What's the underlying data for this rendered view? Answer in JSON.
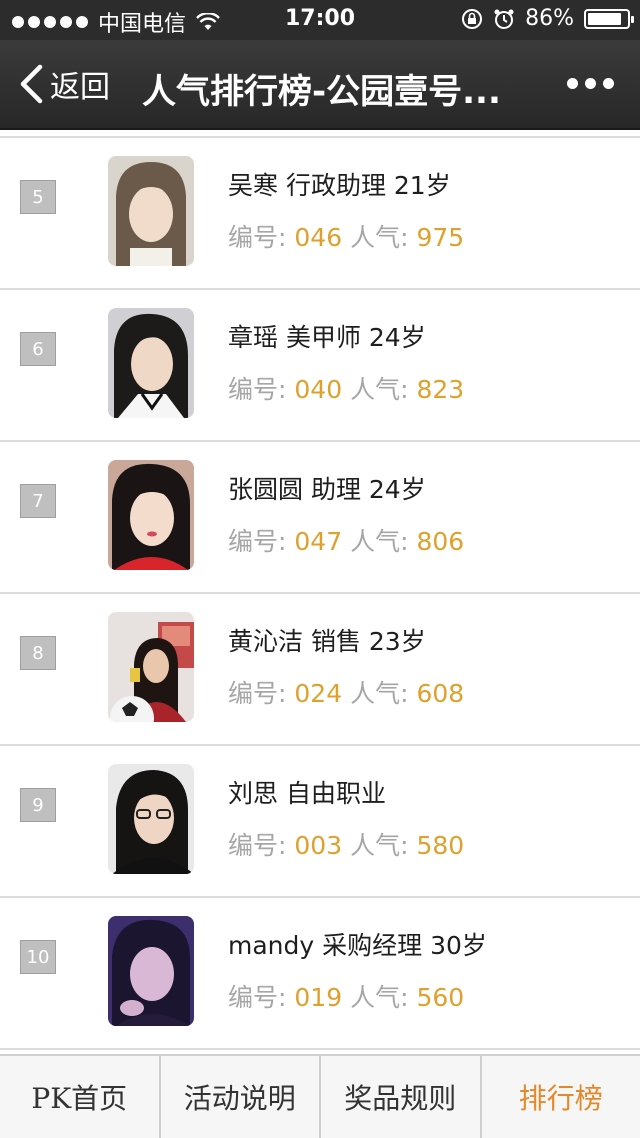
{
  "status": {
    "carrier": "中国电信",
    "time": "17:00",
    "battery": "86%",
    "battery_level": 0.86
  },
  "nav": {
    "back_label": "返回",
    "title": "人气排行榜-公园壹号..."
  },
  "labels": {
    "id_prefix": "编号:",
    "pop_prefix": "人气:"
  },
  "entries": [
    {
      "rank": "5",
      "name": "吴寒 行政助理 21岁",
      "id": "046",
      "popularity": "975"
    },
    {
      "rank": "6",
      "name": "章瑶 美甲师 24岁",
      "id": "040",
      "popularity": "823"
    },
    {
      "rank": "7",
      "name": "张圆圆 助理 24岁",
      "id": "047",
      "popularity": "806"
    },
    {
      "rank": "8",
      "name": "黄沁洁 销售 23岁",
      "id": "024",
      "popularity": "608"
    },
    {
      "rank": "9",
      "name": "刘思 自由职业",
      "id": "003",
      "popularity": "580"
    },
    {
      "rank": "10",
      "name": "mandy 采购经理 30岁",
      "id": "019",
      "popularity": "560"
    }
  ],
  "tabs": [
    {
      "label": "PK首页"
    },
    {
      "label": "活动说明"
    },
    {
      "label": "奖品规则"
    },
    {
      "label": "排行榜",
      "active": true
    }
  ],
  "colors": {
    "accent": "#e0a12c",
    "active_tab": "#e3892a",
    "navbar": "#2c2c2c"
  }
}
